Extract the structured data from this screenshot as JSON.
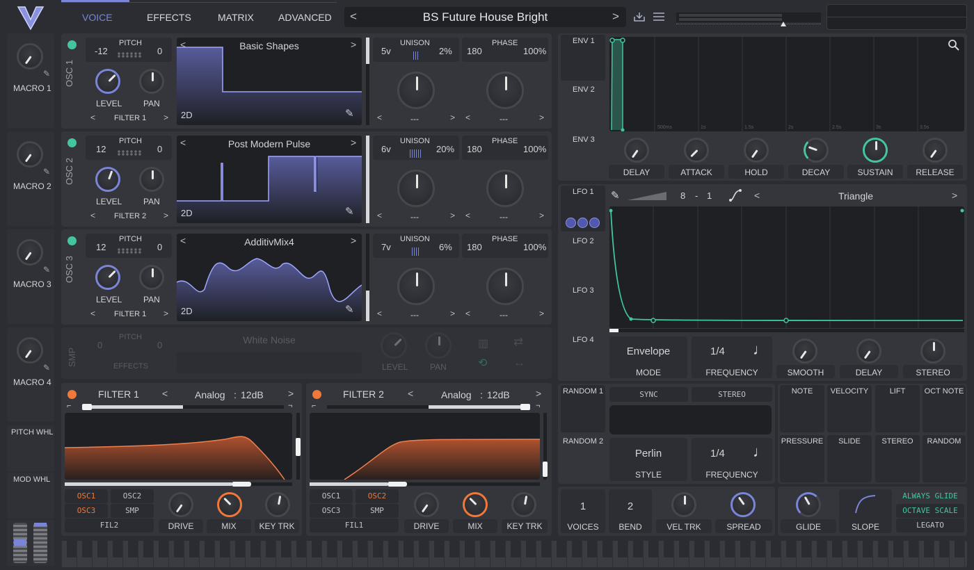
{
  "nav": {
    "tabs": [
      "VOICE",
      "EFFECTS",
      "MATRIX",
      "ADVANCED"
    ],
    "active": "VOICE"
  },
  "preset": {
    "name": "BS Future House Bright",
    "prev": "<",
    "next": ">"
  },
  "macros": [
    {
      "label": "MACRO 1"
    },
    {
      "label": "MACRO 2"
    },
    {
      "label": "MACRO 3"
    },
    {
      "label": "MACRO 4"
    }
  ],
  "wheels": {
    "pitch": "PITCH WHL",
    "mod": "MOD WHL"
  },
  "oscs": [
    {
      "label": "OSC 1",
      "pitch_left": "-12",
      "pitch_title": "PITCH",
      "pitch_right": "0",
      "level": "LEVEL",
      "pan": "PAN",
      "filter": "FILTER 1",
      "wave_name": "Basic Shapes",
      "dim": "2D",
      "unison_voices": "5v",
      "unison_title": "UNISON",
      "unison_pct": "2%",
      "phase_left": "180",
      "phase_title": "PHASE",
      "phase_pct": "100%",
      "sel1": "---",
      "sel2": "---"
    },
    {
      "label": "OSC 2",
      "pitch_left": "12",
      "pitch_title": "PITCH",
      "pitch_right": "0",
      "level": "LEVEL",
      "pan": "PAN",
      "filter": "FILTER 2",
      "wave_name": "Post Modern Pulse",
      "dim": "2D",
      "unison_voices": "6v",
      "unison_title": "UNISON",
      "unison_pct": "20%",
      "phase_left": "180",
      "phase_title": "PHASE",
      "phase_pct": "100%",
      "sel1": "---",
      "sel2": "---"
    },
    {
      "label": "OSC 3",
      "pitch_left": "12",
      "pitch_title": "PITCH",
      "pitch_right": "0",
      "level": "LEVEL",
      "pan": "PAN",
      "filter": "FILTER 1",
      "wave_name": "AdditivMix4",
      "dim": "2D",
      "unison_voices": "7v",
      "unison_title": "UNISON",
      "unison_pct": "6%",
      "phase_left": "180",
      "phase_title": "PHASE",
      "phase_pct": "100%",
      "sel1": "---",
      "sel2": "---"
    }
  ],
  "smp": {
    "label": "SMP",
    "pitch_left": "0",
    "pitch_title": "PITCH",
    "pitch_right": "0",
    "effects": "EFFECTS",
    "wave_name": "White Noise",
    "level": "LEVEL",
    "pan": "PAN"
  },
  "filters": [
    {
      "title": "FILTER 1",
      "model": "Analog",
      "sep": ":",
      "slope": "12dB",
      "routes": [
        "OSC1",
        "OSC2",
        "OSC3",
        "SMP"
      ],
      "route_active": [
        "OSC1",
        "OSC3"
      ],
      "fil": "FIL2",
      "drive": "DRIVE",
      "mix": "MIX",
      "key": "KEY TRK"
    },
    {
      "title": "FILTER 2",
      "model": "Analog",
      "sep": ":",
      "slope": "12dB",
      "routes": [
        "OSC1",
        "OSC2",
        "OSC3",
        "SMP"
      ],
      "route_active": [
        "OSC2"
      ],
      "fil": "FIL1",
      "drive": "DRIVE",
      "mix": "MIX",
      "key": "KEY TRK"
    }
  ],
  "envs": {
    "tabs": [
      "ENV 1",
      "ENV 2",
      "ENV 3"
    ],
    "knobs": [
      "DELAY",
      "ATTACK",
      "HOLD",
      "DECAY",
      "SUSTAIN",
      "RELEASE"
    ],
    "time_labels": [
      "500ms",
      "1s",
      "1.5s",
      "2s",
      "2.5s",
      "3s",
      "3.5s"
    ]
  },
  "lfos": {
    "tabs": [
      "LFO 1",
      "LFO 2",
      "LFO 3",
      "LFO 4"
    ],
    "rate_a": "8",
    "rate_sep": "-",
    "rate_b": "1",
    "shape": "Triangle",
    "mode_value": "Envelope",
    "mode_label": "MODE",
    "freq_value": "1/4",
    "freq_label": "FREQUENCY",
    "smooth": "SMOOTH",
    "delay": "DELAY",
    "stereo": "STEREO"
  },
  "randoms": {
    "tabs": [
      "RANDOM 1",
      "RANDOM 2"
    ],
    "sync": "SYNC",
    "stereo": "STEREO",
    "style_value": "Perlin",
    "style_label": "STYLE",
    "freq_value": "1/4",
    "freq_label": "FREQUENCY"
  },
  "sources": [
    "NOTE",
    "VELOCITY",
    "LIFT",
    "OCT NOTE",
    "PRESSURE",
    "SLIDE",
    "STEREO",
    "RANDOM"
  ],
  "voice": {
    "voices_value": "1",
    "voices_label": "VOICES",
    "bend_value": "2",
    "bend_label": "BEND",
    "vel_trk": "VEL TRK",
    "spread": "SPREAD",
    "glide": "GLIDE",
    "slope": "SLOPE",
    "always_glide": "ALWAYS GLIDE",
    "octave_scale": "OCTAVE SCALE",
    "legato": "LEGATO"
  },
  "colors": {
    "accent": "#7b85d8",
    "teal": "#43c6a0",
    "orange": "#f07838",
    "osc_on": "#43c6a0"
  }
}
